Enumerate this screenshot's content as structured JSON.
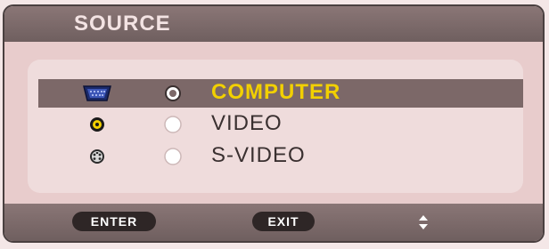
{
  "menu": {
    "title": "SOURCE",
    "options": [
      {
        "label": "COMPUTER",
        "icon": "computer-vga-icon",
        "selected": true
      },
      {
        "label": "VIDEO",
        "icon": "composite-video-icon",
        "selected": false
      },
      {
        "label": "S-VIDEO",
        "icon": "svideo-icon",
        "selected": false
      }
    ]
  },
  "footer": {
    "enter_label": "ENTER",
    "exit_label": "EXIT",
    "navigate_icon": "up-down-arrows-icon"
  },
  "colors": {
    "selected_text": "#f2d000",
    "highlight_bar": "#7c6868",
    "frame": "#4a4040"
  }
}
